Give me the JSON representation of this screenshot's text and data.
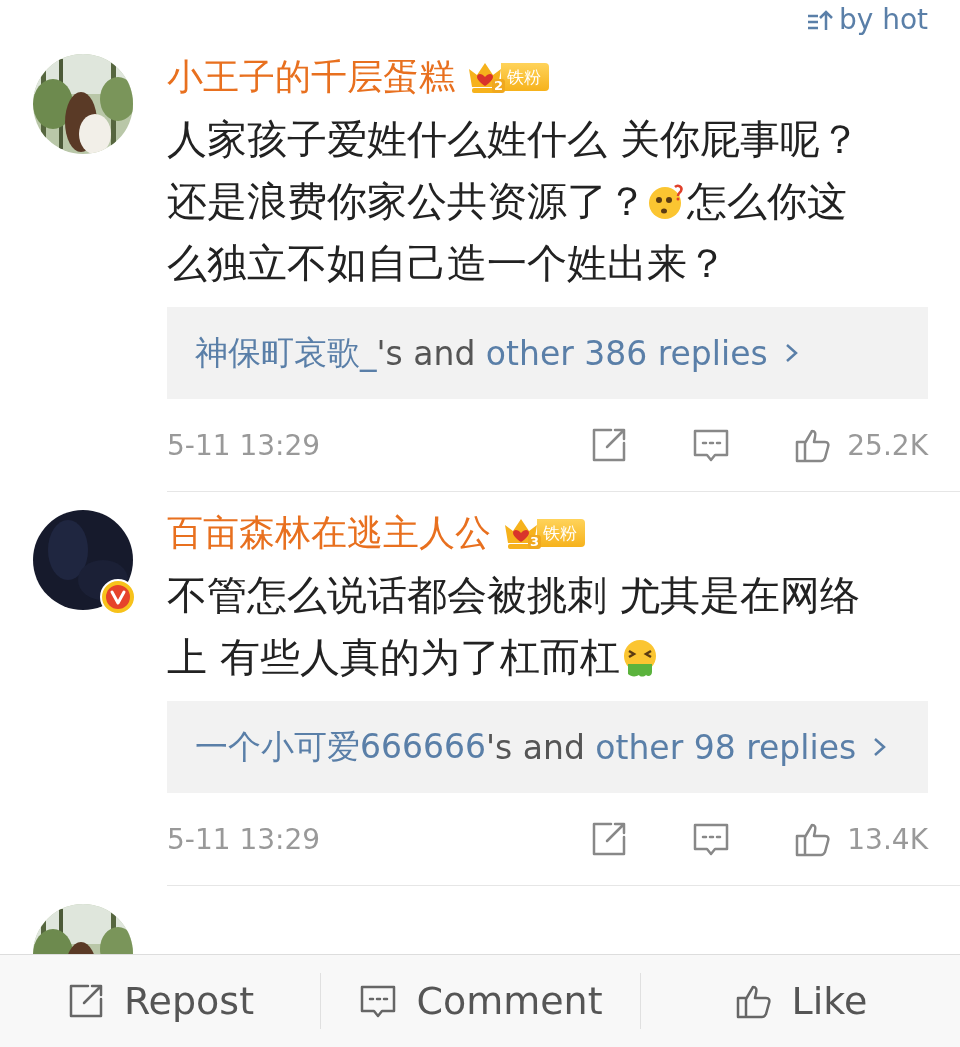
{
  "sort": {
    "label": "by hot"
  },
  "comments": [
    {
      "avatar": {
        "kind": "picture",
        "verified": false
      },
      "name": "小王子的千层蛋糕",
      "fan_badge": {
        "level": "2",
        "label": "铁粉"
      },
      "body": [
        {
          "kind": "text",
          "text": "人家孩子爱姓什么姓什么 关你屁事呢？还是浪费你家公共资源了？"
        },
        {
          "kind": "puzzled-emoji"
        },
        {
          "kind": "text",
          "text": "怎么你这么独立不如自己造一个姓出来？"
        }
      ],
      "replies": {
        "replier": "神保町哀歌_",
        "connector": "'s and",
        "more": "other 386 replies"
      },
      "time": "5-11 13:29",
      "likes": "25.2K"
    },
    {
      "avatar": {
        "kind": "dark",
        "verified": true
      },
      "name": "百亩森林在逃主人公",
      "fan_badge": {
        "level": "3",
        "label": "铁粉"
      },
      "body": [
        {
          "kind": "text",
          "text": "不管怎么说话都会被挑刺 尤其是在网络上 有些人真的为了杠而杠"
        },
        {
          "kind": "sick-emoji"
        }
      ],
      "replies": {
        "replier": "一个小可爱666666",
        "connector": "'s and",
        "more": "other 98 replies"
      },
      "time": "5-11 13:29",
      "likes": "13.4K"
    },
    {
      "avatar": {
        "kind": "picture"
      }
    }
  ],
  "bottom_bar": [
    {
      "kind": "repost",
      "label": "Repost"
    },
    {
      "kind": "comment",
      "label": "Comment"
    },
    {
      "kind": "like",
      "label": "Like"
    }
  ]
}
